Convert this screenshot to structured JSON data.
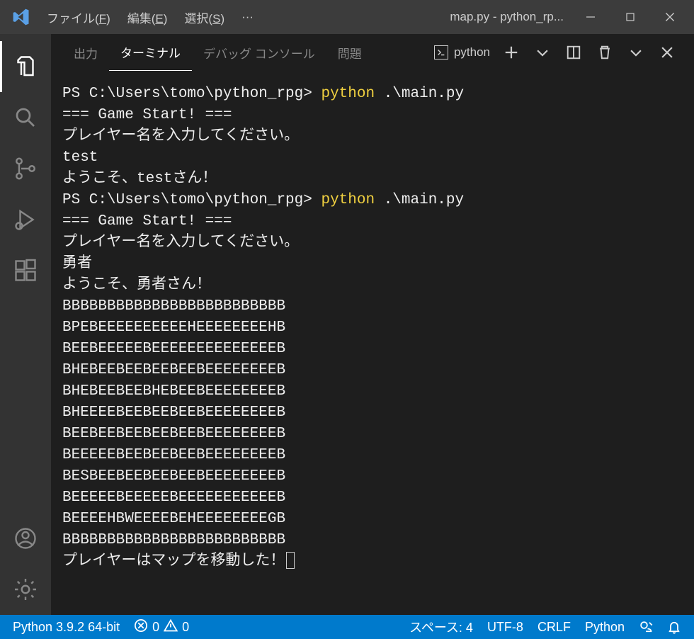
{
  "titlebar": {
    "menus": [
      {
        "pre": "ファイル(",
        "u": "F",
        "post": ")"
      },
      {
        "pre": "編集(",
        "u": "E",
        "post": ")"
      },
      {
        "pre": "選択(",
        "u": "S",
        "post": ")"
      }
    ],
    "dots": "···",
    "title": "map.py - python_rp..."
  },
  "panel": {
    "tabs": {
      "output": "出力",
      "terminal": "ターミナル",
      "debug_console": "デバッグ コンソール",
      "problems": "問題"
    },
    "shell_label": "python"
  },
  "terminal": {
    "lines": [
      [
        {
          "text": "PS C:\\Users\\tomo\\python_rpg> ",
          "cls": ""
        },
        {
          "text": "python",
          "cls": "term-yellow"
        },
        {
          "text": " .\\main.py",
          "cls": ""
        }
      ],
      [
        {
          "text": "=== Game Start! ===",
          "cls": ""
        }
      ],
      [
        {
          "text": "プレイヤー名を入力してください。",
          "cls": ""
        }
      ],
      [
        {
          "text": "test",
          "cls": ""
        }
      ],
      [
        {
          "text": "ようこそ、testさん！",
          "cls": ""
        }
      ],
      [
        {
          "text": "PS C:\\Users\\tomo\\python_rpg> ",
          "cls": ""
        },
        {
          "text": "python",
          "cls": "term-yellow"
        },
        {
          "text": " .\\main.py",
          "cls": ""
        }
      ],
      [
        {
          "text": "=== Game Start! ===",
          "cls": ""
        }
      ],
      [
        {
          "text": "プレイヤー名を入力してください。",
          "cls": ""
        }
      ],
      [
        {
          "text": "勇者",
          "cls": ""
        }
      ],
      [
        {
          "text": "ようこそ、勇者さん！",
          "cls": ""
        }
      ],
      [
        {
          "text": "BBBBBBBBBBBBBBBBBBBBBBBBB",
          "cls": ""
        }
      ],
      [
        {
          "text": "BPEBEEEEEEEEEEHEEEEEEEEHB",
          "cls": ""
        }
      ],
      [
        {
          "text": "BEEBEEEEEBEEEEEEEEEEEEEEB",
          "cls": ""
        }
      ],
      [
        {
          "text": "BHEBEEBEEBEEBEEBEEEEEEEEB",
          "cls": ""
        }
      ],
      [
        {
          "text": "BHEBEEBEEBHEBEEBEEEEEEEEB",
          "cls": ""
        }
      ],
      [
        {
          "text": "BHEEEEBEEBEEBEEBEEEEEEEEB",
          "cls": ""
        }
      ],
      [
        {
          "text": "BEEBEEBEEBEEBEEBEEEEEEEEB",
          "cls": ""
        }
      ],
      [
        {
          "text": "BEEEEEBEEBEEBEEBEEEEEEEEB",
          "cls": ""
        }
      ],
      [
        {
          "text": "BESBEEBEEBEEBEEBEEEEEEEEB",
          "cls": ""
        }
      ],
      [
        {
          "text": "BEEEEEBEEEEEBEEEEEEEEEEEB",
          "cls": ""
        }
      ],
      [
        {
          "text": "BEEEEHBWEEEEBEHEEEEEEEEGB",
          "cls": ""
        }
      ],
      [
        {
          "text": "BBBBBBBBBBBBBBBBBBBBBBBBB",
          "cls": ""
        }
      ],
      [
        {
          "text": "プレイヤーはマップを移動した！",
          "cls": "",
          "cursor": true
        }
      ]
    ]
  },
  "statusbar": {
    "python_version": "Python 3.9.2 64-bit",
    "errors": "0",
    "warnings": "0",
    "spaces": "スペース: 4",
    "encoding": "UTF-8",
    "eol": "CRLF",
    "lang": "Python"
  }
}
